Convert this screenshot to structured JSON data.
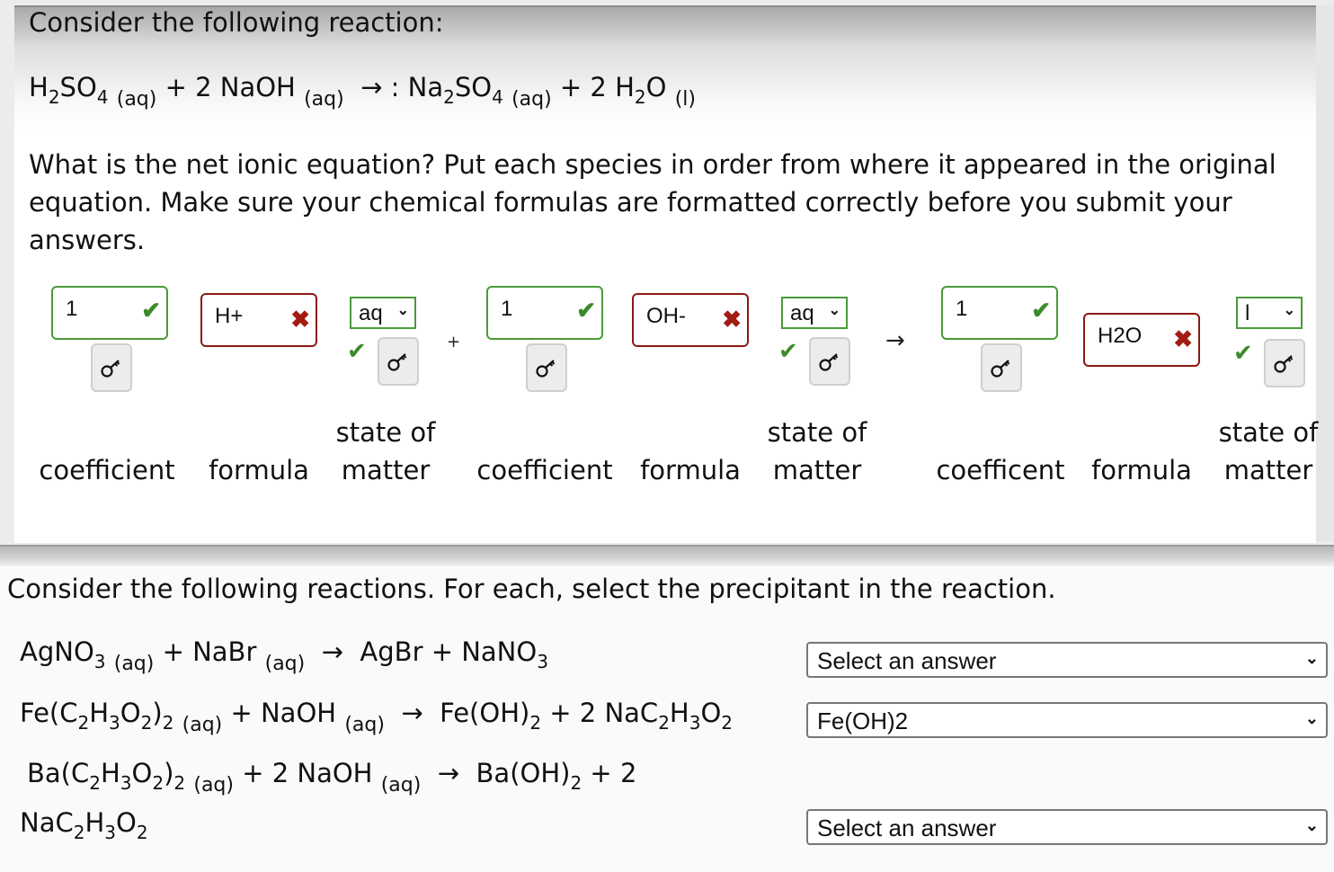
{
  "question1": {
    "title": "Consider the following reaction:",
    "equation": {
      "reactant1": {
        "text": "H",
        "sub1": "2",
        "text2": "SO",
        "sub2": "4",
        "state": "(aq)"
      },
      "plus1": "+ 2 NaOH",
      "state2": "(aq)",
      "arrow": "→ :",
      "product1": {
        "text": "Na",
        "sub1": "2",
        "text2": "SO",
        "sub2": "4",
        "state": "(aq)"
      },
      "plus2": "+ 2 H",
      "sub_h2o": "2",
      "o": "O",
      "state4": "(l)"
    },
    "prompt": "What is the net ionic equation?  Put each species in order from where it appeared in the original equation.  Make sure your chemical formulas are formatted correctly before you submit your answers.",
    "groups": [
      {
        "coefficient": "1",
        "coefficient_status": "correct",
        "formula": "H+",
        "formula_status": "incorrect",
        "state": "aq",
        "state_status": "correct",
        "labels": {
          "coefficient": "coefficient",
          "formula": "formula",
          "state": "state of matter"
        }
      },
      {
        "coefficient": "1",
        "coefficient_status": "correct",
        "formula": "OH-",
        "formula_status": "incorrect",
        "state": "aq",
        "state_status": "correct",
        "labels": {
          "coefficient": "coefficient",
          "formula": "formula",
          "state": "state of matter"
        }
      },
      {
        "coefficient": "1",
        "coefficient_status": "correct",
        "formula": "H2O",
        "formula_status": "incorrect",
        "state": "l",
        "state_status": "correct",
        "labels": {
          "coefficient": "coefficent",
          "formula": "formula",
          "state": "state of matter"
        }
      }
    ],
    "operators": {
      "plus": "+",
      "arrow": "→"
    },
    "icons": {
      "correct": "✔",
      "incorrect": "✖",
      "key": "key-icon",
      "chevron": "chevron-down-icon"
    },
    "colors": {
      "correct": "#4a9a3a",
      "incorrect": "#8b1a12"
    }
  },
  "question2": {
    "title": "Consider the following reactions.  For each, select the precipitant in the reaction.",
    "reactions": [
      {
        "selected": "Select an answer"
      },
      {
        "selected": "Fe(OH)2"
      },
      {
        "selected": "Select an answer"
      }
    ],
    "labels": {
      "aq": "(aq)",
      "plus": "+",
      "arrow": "→",
      "r1": {
        "a": "AgNO",
        "a_sub": "3",
        "b": "+ NaBr",
        "c": "AgBr + NaNO",
        "c_sub": "3"
      },
      "r2": {
        "a": "Fe(C",
        "b": "H",
        "c": "O",
        "d": ")",
        "e": "+ NaOH",
        "f": "Fe(OH)",
        "g": "+ 2 NaC",
        "h": "H",
        "i": "O"
      },
      "r3": {
        "a": "Ba(C",
        "b": "H",
        "c": "O",
        "d": ")",
        "e": "+ 2 NaOH",
        "f": "Ba(OH)",
        "g": "+ 2",
        "h": "NaC",
        "i": "H",
        "j": "O"
      },
      "sub2": "2",
      "sub3": "3"
    }
  }
}
